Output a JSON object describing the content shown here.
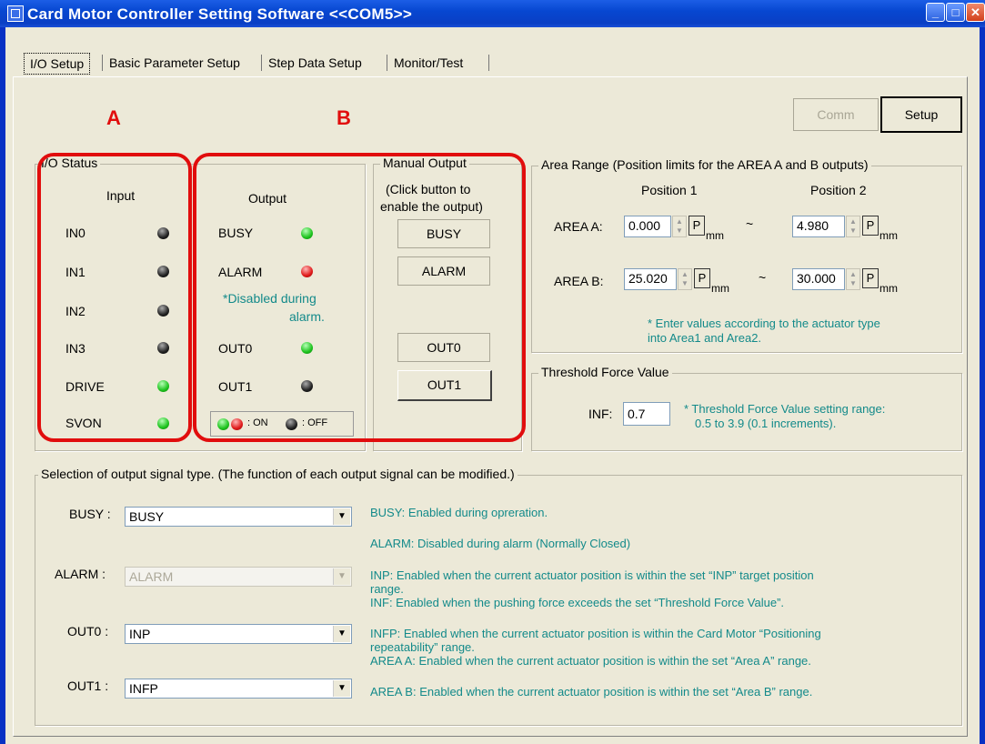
{
  "window": {
    "title": "Card Motor Controller Setting Software <<COM5>>"
  },
  "tabs": [
    "I/O Setup",
    "Basic Parameter Setup",
    "Step Data Setup",
    "Monitor/Test"
  ],
  "top_buttons": {
    "comm": "Comm",
    "setup": "Setup"
  },
  "annotations": {
    "a": "A",
    "b": "B"
  },
  "io_status": {
    "legend": "I/O Status",
    "input_header": "Input",
    "inputs": [
      {
        "label": "IN0",
        "state": "black"
      },
      {
        "label": "IN1",
        "state": "black"
      },
      {
        "label": "IN2",
        "state": "black"
      },
      {
        "label": "IN3",
        "state": "black"
      },
      {
        "label": "DRIVE",
        "state": "green"
      },
      {
        "label": "SVON",
        "state": "green"
      }
    ],
    "output_header": "Output",
    "outputs": [
      {
        "label": "BUSY",
        "state": "green"
      },
      {
        "label": "ALARM",
        "state": "red"
      },
      {
        "label": "OUT0",
        "state": "green"
      },
      {
        "label": "OUT1",
        "state": "black"
      }
    ],
    "alarm_note_line1": "*Disabled during",
    "alarm_note_line2": "alarm.",
    "legend_on": ": ON",
    "legend_off": ": OFF"
  },
  "manual_output": {
    "legend": "Manual Output",
    "hint_line1": "(Click button to",
    "hint_line2": "enable the output)",
    "buttons": [
      "BUSY",
      "ALARM",
      "OUT0",
      "OUT1"
    ]
  },
  "area_range": {
    "legend": "Area Range (Position limits for the AREA A and B outputs)",
    "pos1": "Position 1",
    "pos2": "Position 2",
    "area_a_label": "AREA A:",
    "area_a_p1": "0.000",
    "area_a_p2": "4.980",
    "area_b_label": "AREA B:",
    "area_b_p1": "25.020",
    "area_b_p2": "30.000",
    "p": "P",
    "unit": "mm",
    "tilde": "~",
    "note_line1": "* Enter values according to the actuator type",
    "note_line2": "into Area1 and Area2."
  },
  "threshold": {
    "legend": "Threshold Force Value",
    "label": "INF:",
    "value": "0.7",
    "note_line1": "* Threshold Force Value setting range:",
    "note_line2": "0.5 to 3.9 (0.1 increments)."
  },
  "selection": {
    "legend": "Selection of output signal type. (The function of each output signal can be modified.)",
    "busy_label": "BUSY :",
    "busy_value": "BUSY",
    "alarm_label": "ALARM :",
    "alarm_value": "ALARM",
    "out0_label": "OUT0 :",
    "out0_value": "INP",
    "out1_label": "OUT1 :",
    "out1_value": "INFP",
    "descriptions": [
      "BUSY: Enabled during opreration.",
      "ALARM: Disabled during alarm (Normally Closed)",
      "INP: Enabled when the current actuator position is within the set “INP” target position",
      "range.",
      "INF: Enabled when the pushing force exceeds the set “Threshold Force Value”.",
      "INFP: Enabled when the current actuator position is within the Card Motor “Positioning",
      "repeatability” range.",
      "AREA A: Enabled when the current actuator position is within the set “Area A” range.",
      "AREA B: Enabled when the current actuator position is within the set “Area B” range."
    ]
  },
  "colors": {
    "led_on_green": "#1ec31e",
    "led_on_red": "#e01a1a",
    "led_off": "#222222",
    "annotation_red": "#e10d0d",
    "teal_text": "#138a8a"
  }
}
